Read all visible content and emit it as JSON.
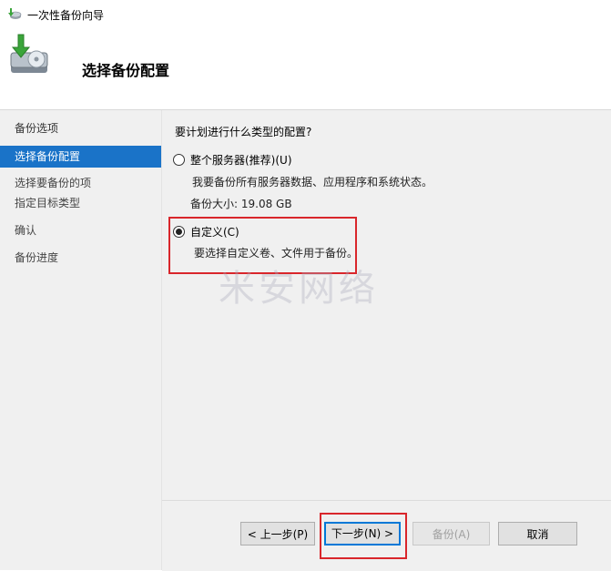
{
  "window": {
    "title": "一次性备份向导"
  },
  "header": {
    "title": "选择备份配置"
  },
  "sidebar": {
    "items": [
      {
        "label": "备份选项"
      },
      {
        "label": "选择备份配置"
      },
      {
        "label": "选择要备份的项"
      },
      {
        "label": "指定目标类型"
      },
      {
        "label": "确认"
      },
      {
        "label": "备份进度"
      }
    ]
  },
  "main": {
    "question": "要计划进行什么类型的配置?",
    "options": [
      {
        "label": "整个服务器(推荐)(U)",
        "description": "我要备份所有服务器数据、应用程序和系统状态。",
        "size": "备份大小: 19.08 GB",
        "checked": false
      },
      {
        "label": "自定义(C)",
        "description": "要选择自定义卷、文件用于备份。",
        "checked": true
      }
    ],
    "watermark": "米安网络"
  },
  "buttons": {
    "prev": "< 上一步(P)",
    "next": "下一步(N) >",
    "backup": "备份(A)",
    "cancel": "取消"
  },
  "colors": {
    "accent": "#1a73c8",
    "highlight": "#d9262b"
  }
}
